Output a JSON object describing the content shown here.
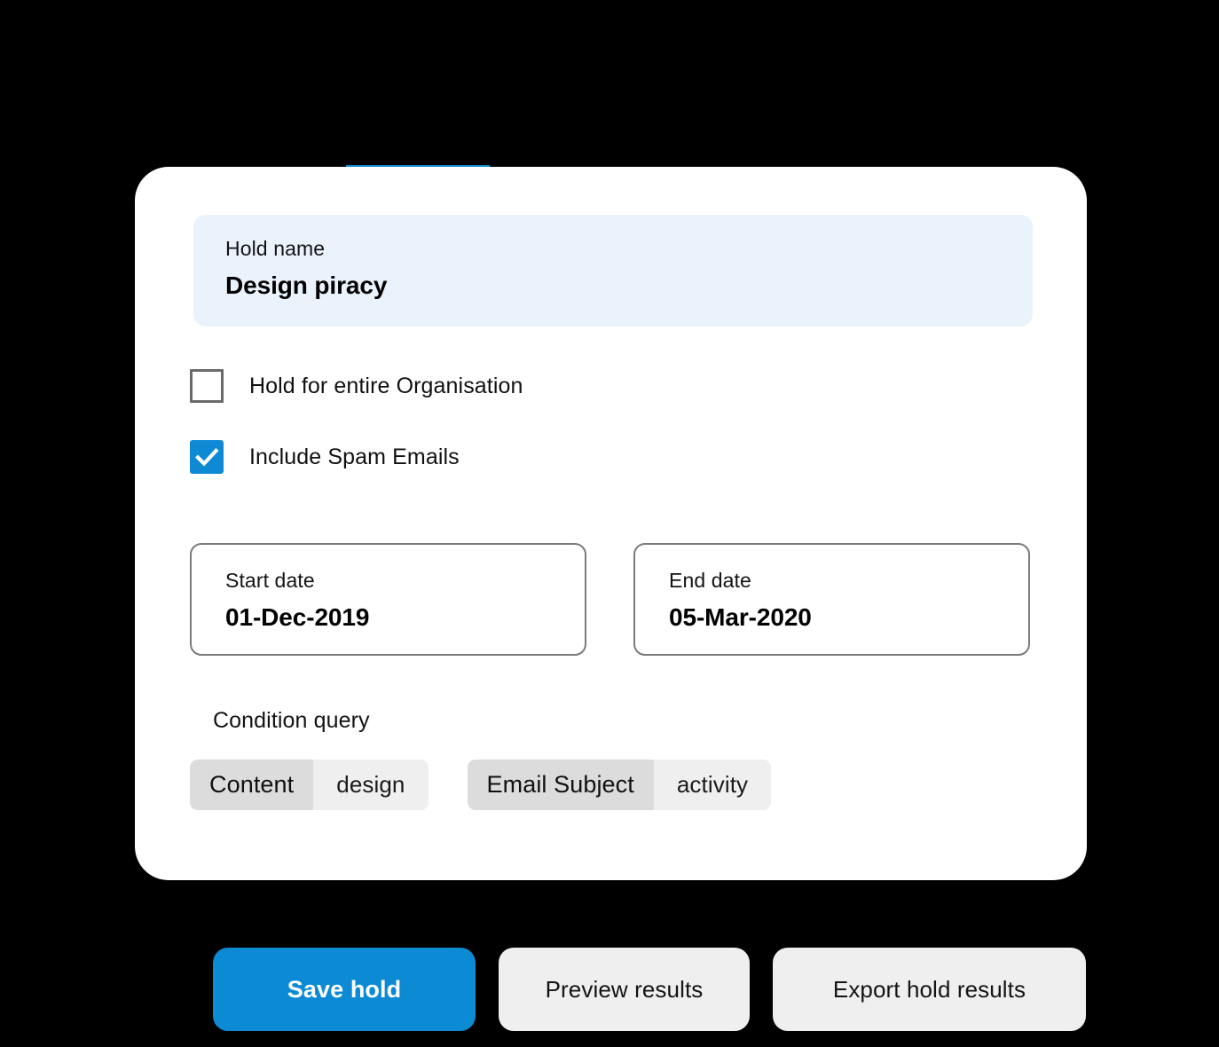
{
  "card": {
    "tab_indicator": {
      "name": "active-tab-indicator",
      "color": "#0c8ad4"
    },
    "hold_name": {
      "label": "Hold name",
      "value": "Design piracy",
      "background": "#eaf2fc"
    },
    "checkboxes": [
      {
        "label": "Hold for entire Organisation",
        "checked": false
      },
      {
        "label": "Include Spam Emails",
        "checked": true,
        "accent": "#0e8ad4"
      }
    ],
    "dates": {
      "start": {
        "label": "Start date",
        "value": "01-Dec-2019"
      },
      "end": {
        "label": "End date",
        "value": "05-Mar-2020"
      }
    },
    "condition_query": {
      "label": "Condition query",
      "chips": [
        {
          "key": "Content",
          "value": "design"
        },
        {
          "key": "Email Subject",
          "value": "activity"
        }
      ]
    }
  },
  "actions": {
    "save": "Save hold",
    "preview": "Preview results",
    "export": "Export hold results",
    "primary_color": "#0c8ad4",
    "secondary_color": "#efefef"
  }
}
